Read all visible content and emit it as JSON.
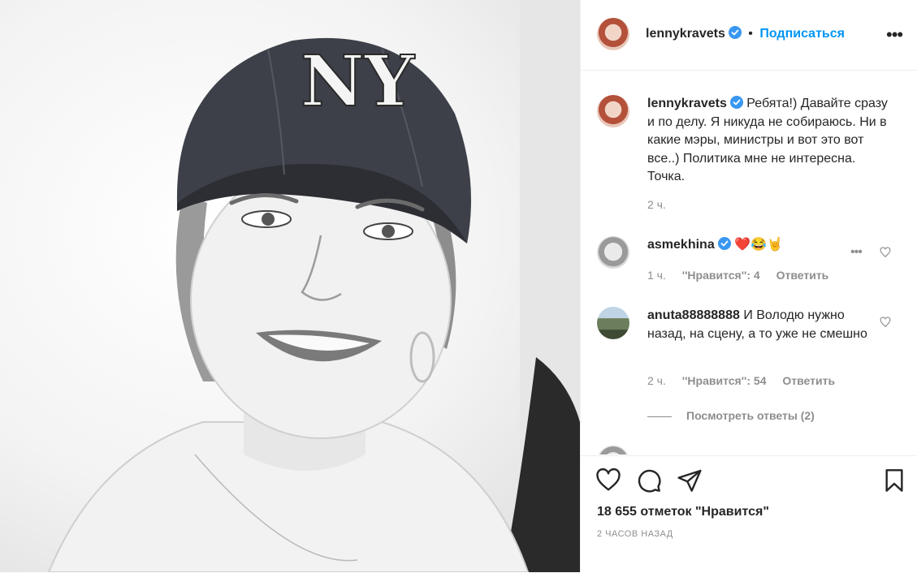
{
  "post": {
    "author": "lennykravets",
    "follow_label": "Подписаться",
    "separator": "•",
    "more_label": "•••",
    "caption": "Ребята!) Давайте сразу и по делу. Я никуда не собираюсь. Ни в какие мэры, министры и вот это вот все..) Политика мне не интересна. Точка.",
    "caption_time": "2 ч.",
    "likes": "18 655 отметок \"Нравится\"",
    "time_ago": "2 ЧАСОВ НАЗАД",
    "photo_text": "NY"
  },
  "comments": [
    {
      "author": "asmekhina",
      "text": "❤️😂🤘",
      "time": "1 ч.",
      "likes": "''Нравится'': 4",
      "reply": "Ответить",
      "more": "•••"
    },
    {
      "author": "anuta88888888",
      "text": "И Володю нужно назад, на сцену, а то уже не смешно",
      "time": "2 ч.",
      "likes": "''Нравится'': 54",
      "reply": "Ответить",
      "view_replies": "Посмотреть ответы (2)"
    }
  ],
  "colors": {
    "accent": "#0095f6",
    "text": "#262626",
    "secondary": "#8e8e8e",
    "border": "#efefef"
  },
  "icons": [
    "verified-badge-icon",
    "heart-icon",
    "comment-icon",
    "share-icon",
    "bookmark-icon",
    "more-icon"
  ]
}
